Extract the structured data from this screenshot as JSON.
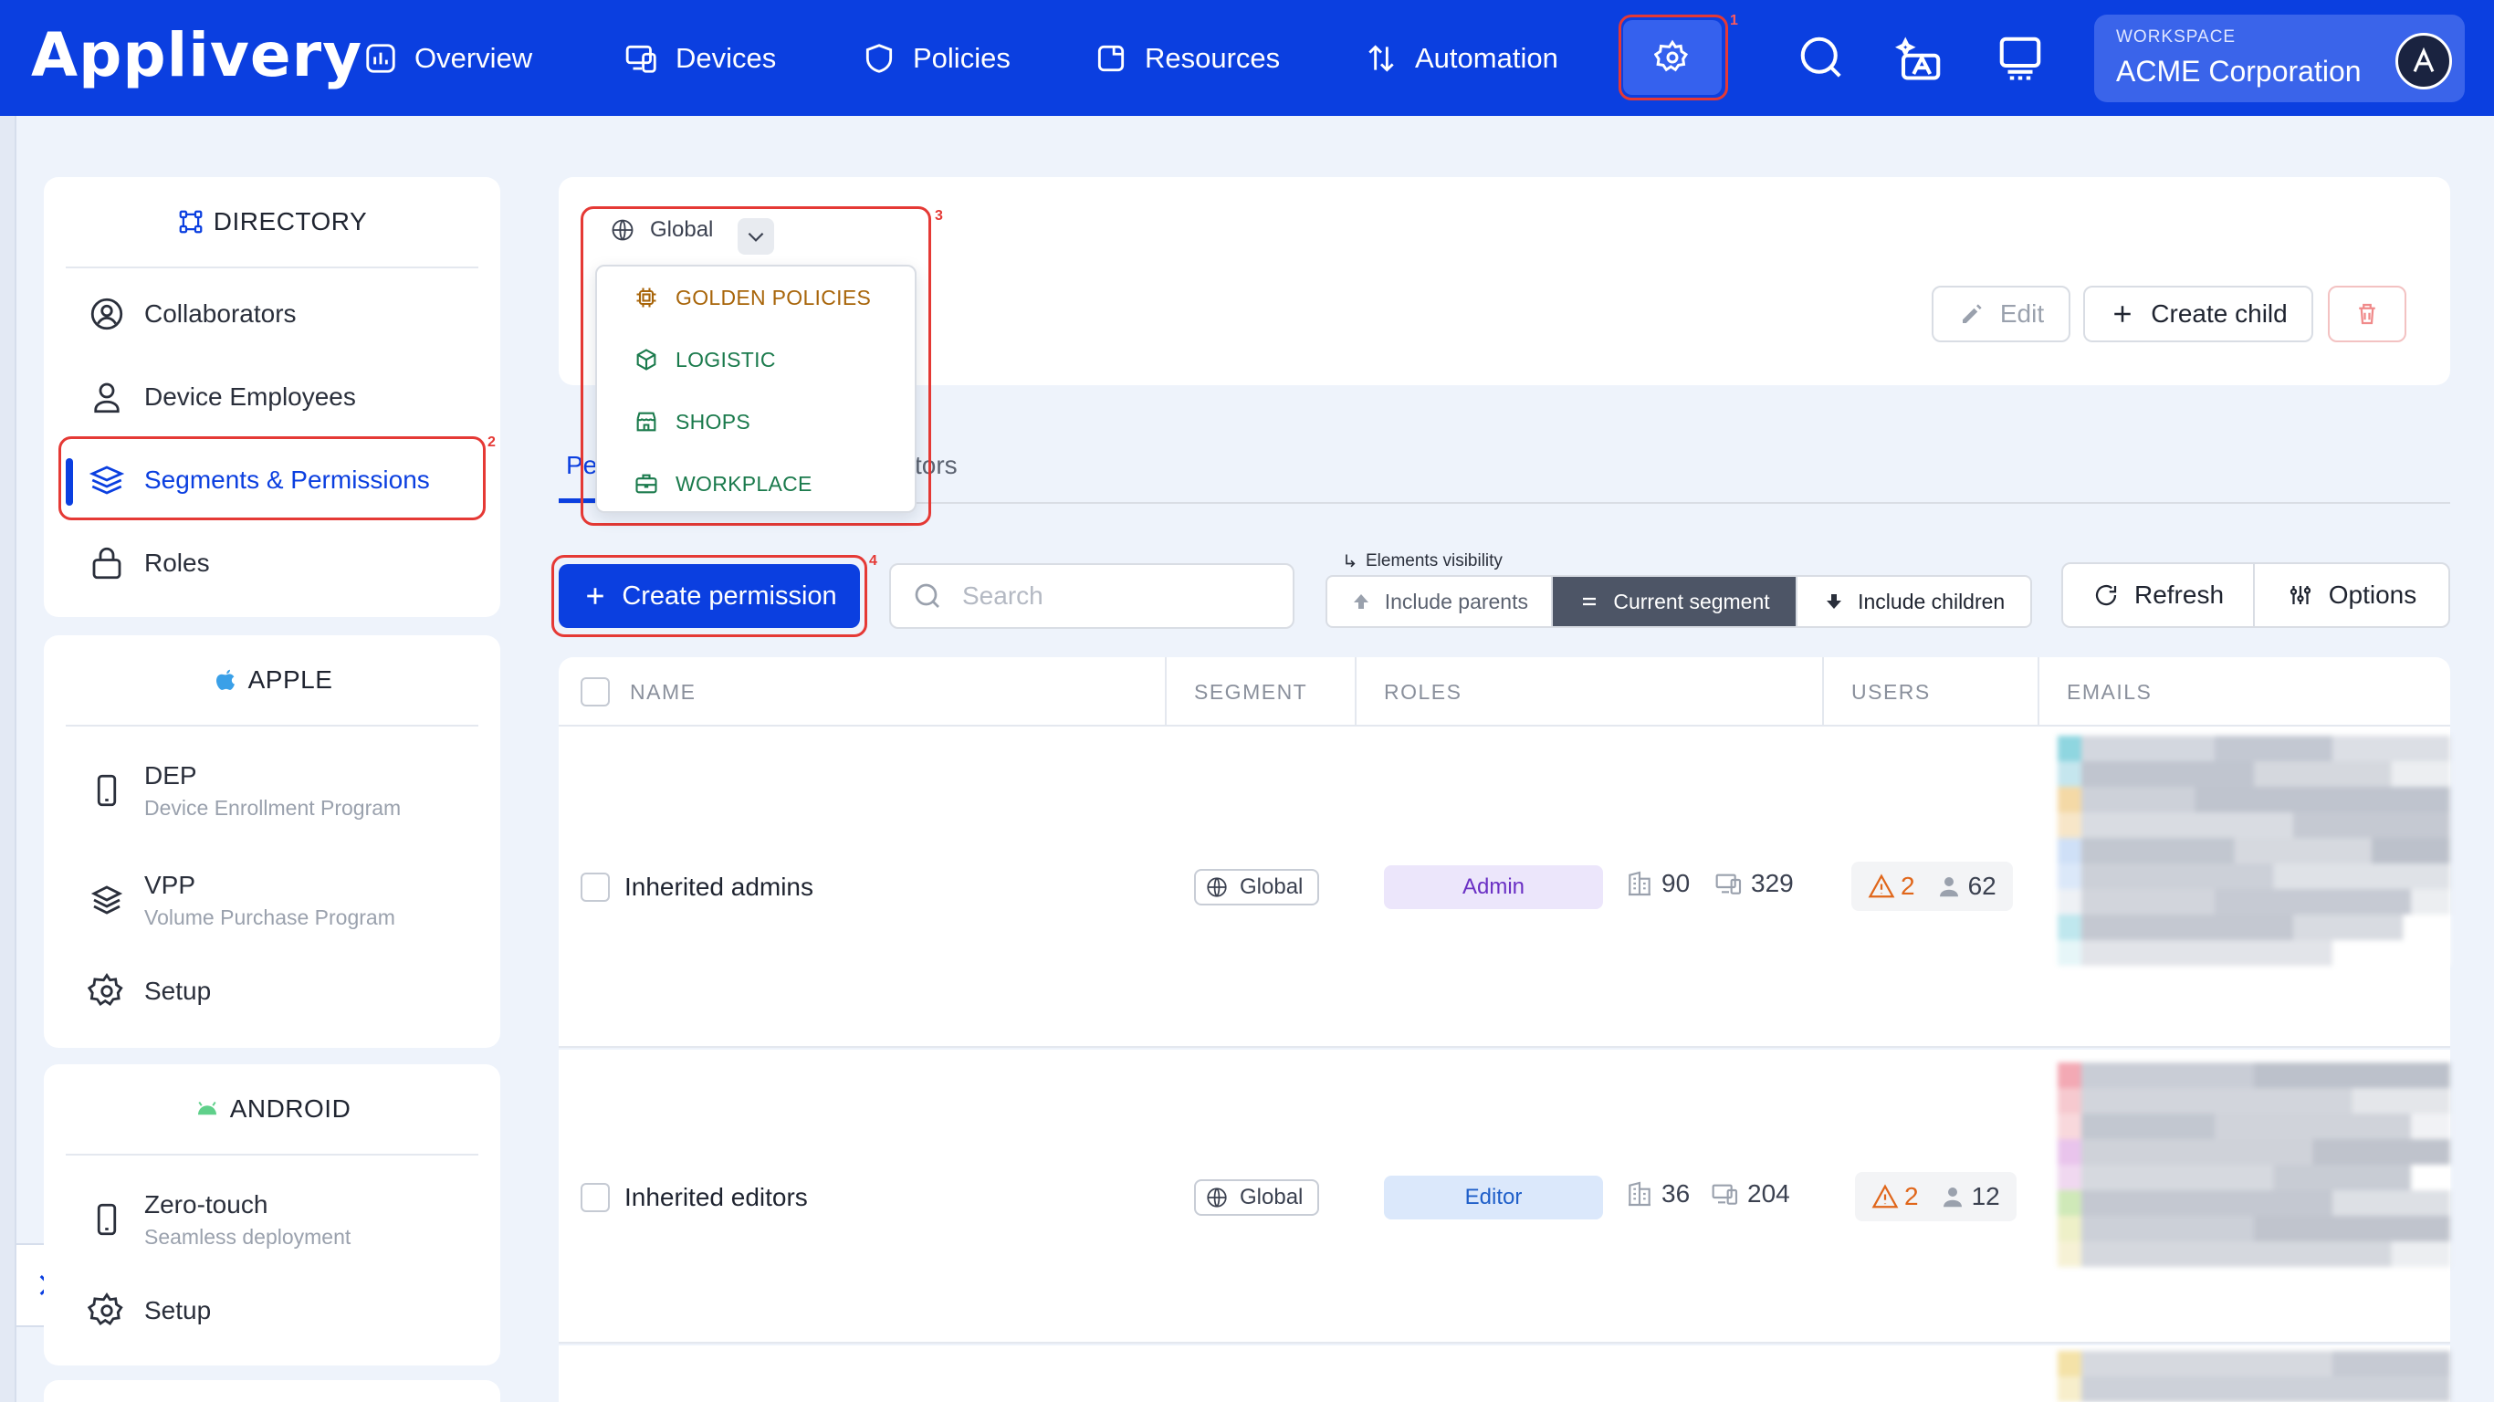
{
  "app": {
    "logo": "Applivery"
  },
  "nav": {
    "overview": "Overview",
    "devices": "Devices",
    "policies": "Policies",
    "resources": "Resources",
    "automation": "Automation"
  },
  "callouts": [
    "1",
    "2",
    "3",
    "4"
  ],
  "workspace": {
    "label": "WORKSPACE",
    "name": "ACME Corporation"
  },
  "sidebar": {
    "directory": {
      "title": "DIRECTORY",
      "items": [
        {
          "label": "Collaborators"
        },
        {
          "label": "Device Employees"
        },
        {
          "label": "Segments & Permissions"
        },
        {
          "label": "Roles"
        }
      ]
    },
    "apple": {
      "title": "APPLE",
      "items": [
        {
          "label": "DEP",
          "sub": "Device Enrollment Program"
        },
        {
          "label": "VPP",
          "sub": "Volume Purchase Program"
        },
        {
          "label": "Setup"
        }
      ]
    },
    "android": {
      "title": "ANDROID",
      "items": [
        {
          "label": "Zero-touch",
          "sub": "Seamless deployment"
        },
        {
          "label": "Setup"
        }
      ]
    }
  },
  "segment": {
    "selected": "Global",
    "options": [
      {
        "label": "GOLDEN POLICIES",
        "color": "#a8650a"
      },
      {
        "label": "LOGISTIC",
        "color": "#1a7a4c"
      },
      {
        "label": "SHOPS",
        "color": "#1a7a4c"
      },
      {
        "label": "WORKPLACE",
        "color": "#1a7a4c"
      }
    ],
    "actions": {
      "edit": "Edit",
      "create_child": "Create child"
    }
  },
  "tabs": {
    "first_partial": "Pe",
    "second_partial": "tors"
  },
  "toolbar": {
    "create_permission": "Create permission",
    "search_placeholder": "Search",
    "visibility_label": "Elements visibility",
    "include_parents": "Include parents",
    "current_segment": "Current segment",
    "include_children": "Include children",
    "refresh": "Refresh",
    "options": "Options"
  },
  "table": {
    "headers": {
      "name": "NAME",
      "segment": "SEGMENT",
      "roles": "ROLES",
      "users": "USERS",
      "emails": "EMAILS"
    },
    "rows": [
      {
        "name": "Inherited admins",
        "segment": "Global",
        "role": "Admin",
        "role_color": "#6a2fc4",
        "role_bg": "#ece6fb",
        "buildings": "90",
        "devices": "329",
        "alerts": "2",
        "users": "62"
      },
      {
        "name": "Inherited editors",
        "segment": "Global",
        "role": "Editor",
        "role_color": "#1f5fc9",
        "role_bg": "#dbe8fb",
        "buildings": "36",
        "devices": "204",
        "alerts": "2",
        "users": "12"
      }
    ]
  },
  "colors": {
    "brand": "#0b3fe0",
    "callout": "#e53935",
    "warning": "#e0661a"
  }
}
